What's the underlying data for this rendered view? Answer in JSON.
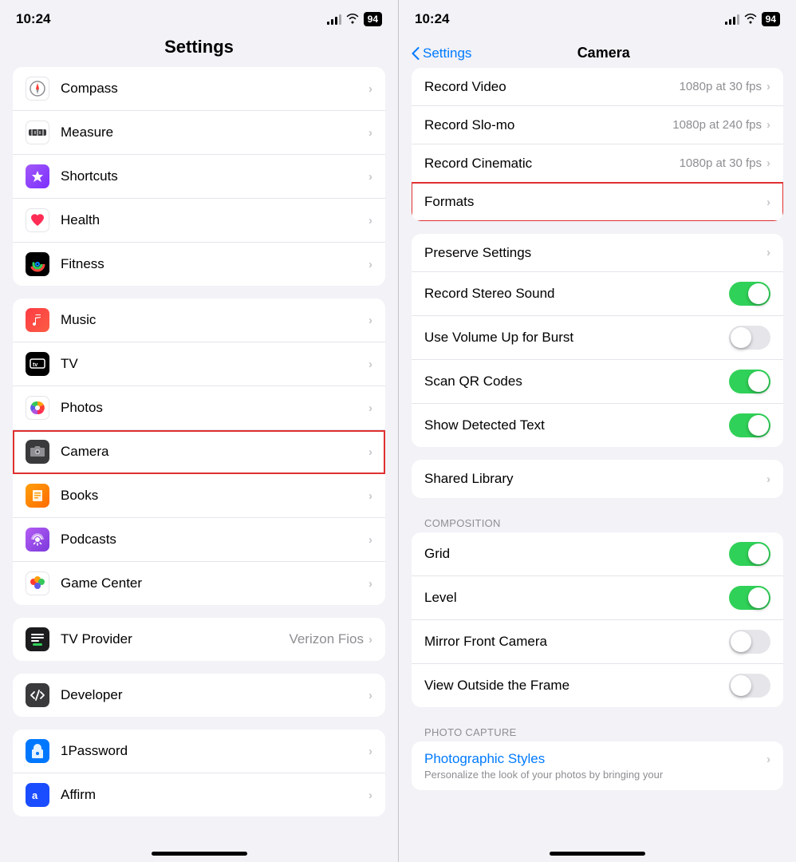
{
  "left": {
    "status": {
      "time": "10:24",
      "battery": "94"
    },
    "title": "Settings",
    "groups": [
      {
        "id": "group1",
        "items": [
          {
            "id": "compass",
            "label": "Compass",
            "icon": "compass",
            "iconBg": "#fff",
            "iconEmoji": "🧭",
            "value": "",
            "highlighted": false
          },
          {
            "id": "measure",
            "label": "Measure",
            "icon": "measure",
            "iconBg": "#fff",
            "iconEmoji": "📏",
            "value": "",
            "highlighted": false
          },
          {
            "id": "shortcuts",
            "label": "Shortcuts",
            "icon": "shortcuts",
            "iconBg": "purple",
            "iconEmoji": "⚡",
            "value": "",
            "highlighted": false
          },
          {
            "id": "health",
            "label": "Health",
            "icon": "health",
            "iconBg": "#fff",
            "iconEmoji": "❤️",
            "value": "",
            "highlighted": false
          },
          {
            "id": "fitness",
            "label": "Fitness",
            "icon": "fitness",
            "iconBg": "ring",
            "iconEmoji": "⬤",
            "value": "",
            "highlighted": false
          }
        ]
      },
      {
        "id": "group2",
        "items": [
          {
            "id": "music",
            "label": "Music",
            "icon": "music",
            "iconBg": "#fc3c44",
            "iconEmoji": "♪",
            "value": "",
            "highlighted": false
          },
          {
            "id": "tv",
            "label": "TV",
            "icon": "tv",
            "iconBg": "#000",
            "iconEmoji": "📺",
            "value": "",
            "highlighted": false
          },
          {
            "id": "photos",
            "label": "Photos",
            "icon": "photos",
            "iconBg": "#fff",
            "iconEmoji": "🌸",
            "value": "",
            "highlighted": false
          },
          {
            "id": "camera",
            "label": "Camera",
            "icon": "camera",
            "iconBg": "#3a3a3c",
            "iconEmoji": "📷",
            "value": "",
            "highlighted": true
          },
          {
            "id": "books",
            "label": "Books",
            "icon": "books",
            "iconBg": "#ff9f0a",
            "iconEmoji": "📖",
            "value": "",
            "highlighted": false
          },
          {
            "id": "podcasts",
            "label": "Podcasts",
            "icon": "podcasts",
            "iconBg": "#b45cf4",
            "iconEmoji": "🎙",
            "value": "",
            "highlighted": false
          },
          {
            "id": "gamecenter",
            "label": "Game Center",
            "icon": "gamecenter",
            "iconBg": "#fff",
            "iconEmoji": "🎮",
            "value": "",
            "highlighted": false
          }
        ]
      },
      {
        "id": "group3",
        "items": [
          {
            "id": "tvprovider",
            "label": "TV Provider",
            "icon": "tvprovider",
            "iconBg": "#1c1c1e",
            "iconEmoji": "$",
            "value": "Verizon Fios",
            "highlighted": false
          }
        ]
      },
      {
        "id": "group4",
        "items": [
          {
            "id": "developer",
            "label": "Developer",
            "icon": "developer",
            "iconBg": "#3a3a3c",
            "iconEmoji": "🔧",
            "value": "",
            "highlighted": false
          }
        ]
      },
      {
        "id": "group5",
        "items": [
          {
            "id": "1password",
            "label": "1Password",
            "icon": "1password",
            "iconBg": "#0077ff",
            "iconEmoji": "①",
            "value": "",
            "highlighted": false
          },
          {
            "id": "affirm",
            "label": "Affirm",
            "icon": "affirm",
            "iconBg": "#1a4dff",
            "iconEmoji": "a",
            "value": "",
            "highlighted": false
          }
        ]
      }
    ]
  },
  "right": {
    "status": {
      "time": "10:24",
      "battery": "94"
    },
    "back_label": "Settings",
    "title": "Camera",
    "groups": [
      {
        "id": "video-group",
        "items": [
          {
            "id": "record-video",
            "label": "Record Video",
            "value": "1080p at 30 fps",
            "type": "nav",
            "highlighted": false
          },
          {
            "id": "record-slomo",
            "label": "Record Slo-mo",
            "value": "1080p at 240 fps",
            "type": "nav",
            "highlighted": false
          },
          {
            "id": "record-cinematic",
            "label": "Record Cinematic",
            "value": "1080p at 30 fps",
            "type": "nav",
            "highlighted": false
          },
          {
            "id": "formats",
            "label": "Formats",
            "value": "",
            "type": "nav",
            "highlighted": true
          }
        ]
      },
      {
        "id": "settings-group",
        "items": [
          {
            "id": "preserve-settings",
            "label": "Preserve Settings",
            "value": "",
            "type": "nav",
            "highlighted": false
          },
          {
            "id": "record-stereo",
            "label": "Record Stereo Sound",
            "value": "",
            "type": "toggle",
            "toggle": true,
            "highlighted": false
          },
          {
            "id": "volume-burst",
            "label": "Use Volume Up for Burst",
            "value": "",
            "type": "toggle",
            "toggle": false,
            "highlighted": false
          },
          {
            "id": "scan-qr",
            "label": "Scan QR Codes",
            "value": "",
            "type": "toggle",
            "toggle": true,
            "highlighted": false
          },
          {
            "id": "show-text",
            "label": "Show Detected Text",
            "value": "",
            "type": "toggle",
            "toggle": true,
            "highlighted": false
          }
        ]
      },
      {
        "id": "shared-group",
        "items": [
          {
            "id": "shared-library",
            "label": "Shared Library",
            "value": "",
            "type": "nav",
            "highlighted": false
          }
        ]
      },
      {
        "id": "composition-group",
        "header": "COMPOSITION",
        "items": [
          {
            "id": "grid",
            "label": "Grid",
            "value": "",
            "type": "toggle",
            "toggle": true,
            "highlighted": false
          },
          {
            "id": "level",
            "label": "Level",
            "value": "",
            "type": "toggle",
            "toggle": true,
            "highlighted": false
          },
          {
            "id": "mirror-front",
            "label": "Mirror Front Camera",
            "value": "",
            "type": "toggle",
            "toggle": false,
            "highlighted": false
          },
          {
            "id": "view-outside",
            "label": "View Outside the Frame",
            "value": "",
            "type": "toggle",
            "toggle": false,
            "highlighted": false
          }
        ]
      },
      {
        "id": "photo-capture-group",
        "header": "PHOTO CAPTURE",
        "items": [
          {
            "id": "photo-styles",
            "label": "Photographic Styles",
            "value": "",
            "type": "nav-blue",
            "desc": "Personalize the look of your photos by bringing your",
            "highlighted": false
          }
        ]
      }
    ]
  }
}
